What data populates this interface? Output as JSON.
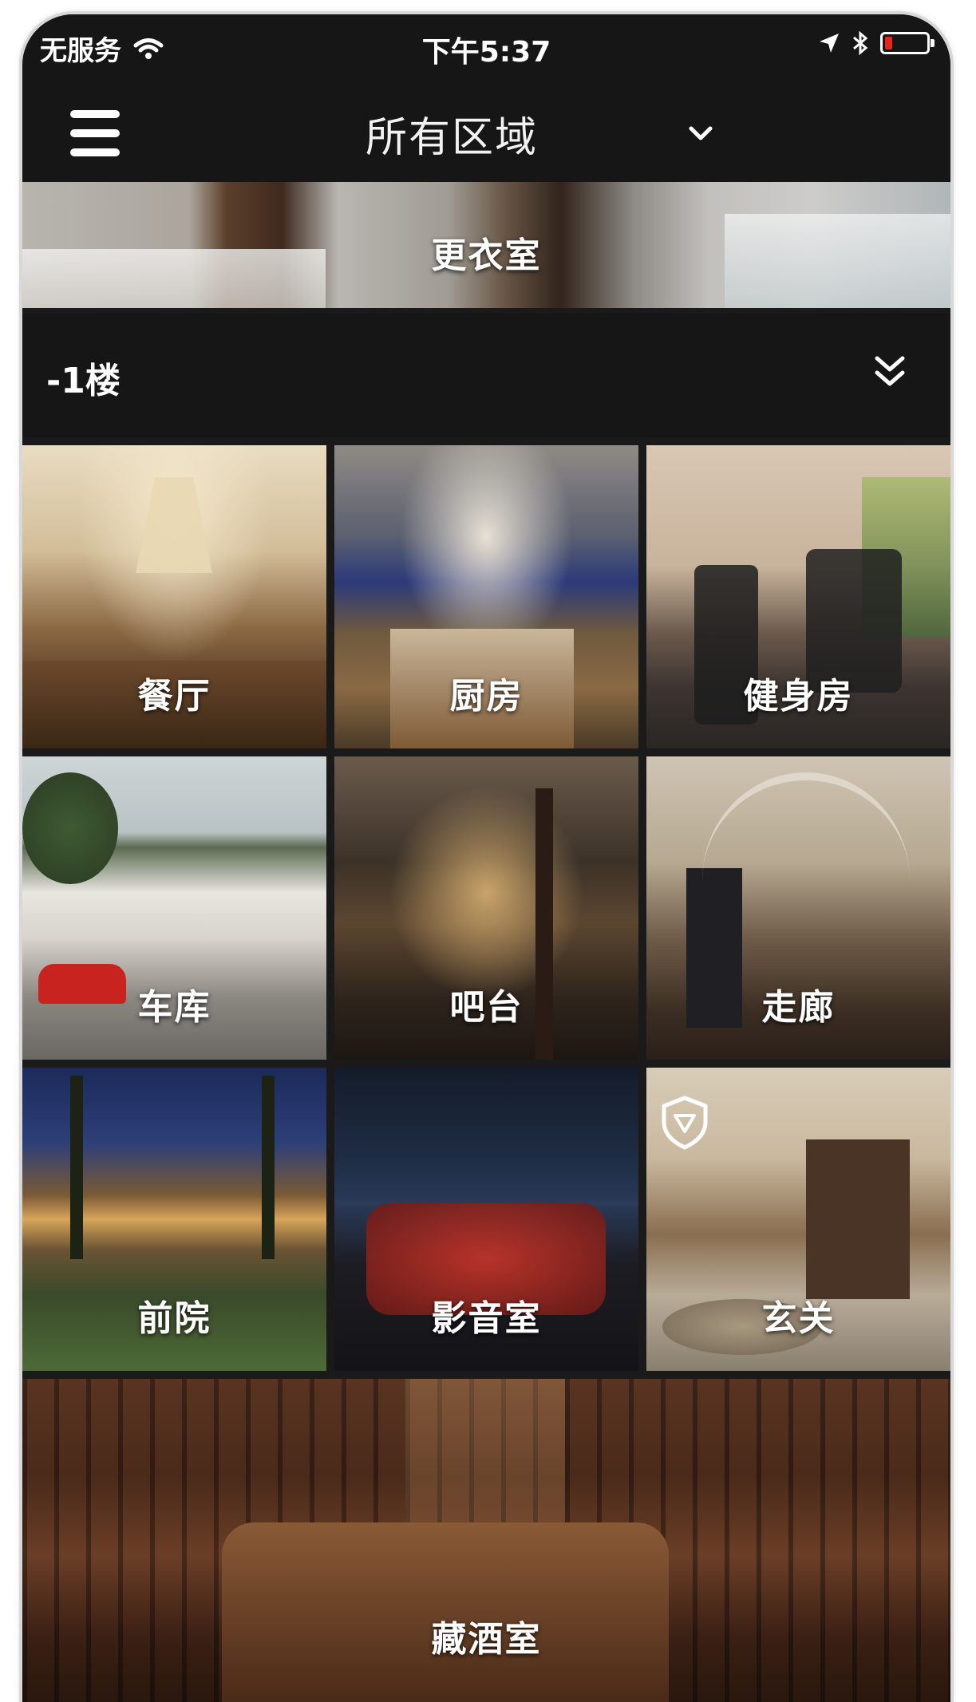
{
  "status_bar": {
    "carrier": "无服务",
    "time": "下午5:37",
    "icons": [
      "wifi-icon",
      "location-icon",
      "bluetooth-icon",
      "battery-icon"
    ]
  },
  "header": {
    "title": "所有区域",
    "menu_icon": "hamburger-menu-icon",
    "dropdown_icon": "chevron-down-icon"
  },
  "top_room": {
    "label": "更衣室"
  },
  "section": {
    "title": "-1楼",
    "icon": "double-chevron-down-icon"
  },
  "rooms": [
    {
      "label": "餐厅"
    },
    {
      "label": "厨房"
    },
    {
      "label": "健身房"
    },
    {
      "label": "车库"
    },
    {
      "label": "吧台"
    },
    {
      "label": "走廊"
    },
    {
      "label": "前院"
    },
    {
      "label": "影音室"
    },
    {
      "label": "玄关"
    }
  ],
  "wide_room": {
    "label": "藏酒室"
  },
  "colors": {
    "background": "#141414",
    "text": "#ffffff",
    "battery_low": "#e8231e"
  }
}
